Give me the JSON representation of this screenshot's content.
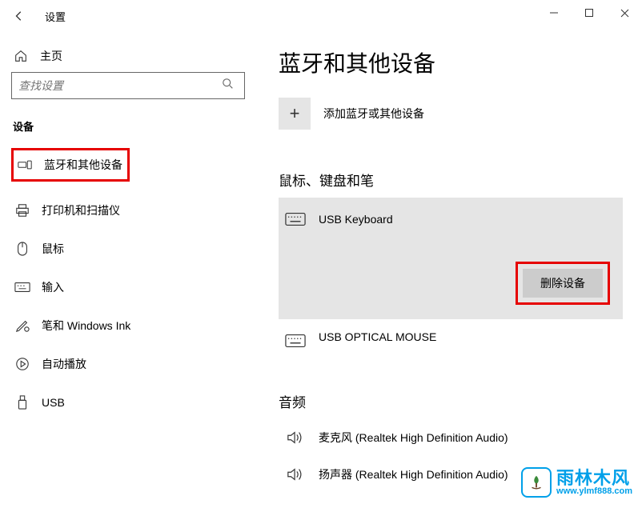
{
  "window": {
    "title": "设置"
  },
  "sidebar": {
    "home": "主页",
    "search_placeholder": "查找设置",
    "category": "设备",
    "items": [
      {
        "label": "蓝牙和其他设备"
      },
      {
        "label": "打印机和扫描仪"
      },
      {
        "label": "鼠标"
      },
      {
        "label": "输入"
      },
      {
        "label": "笔和 Windows Ink"
      },
      {
        "label": "自动播放"
      },
      {
        "label": "USB"
      }
    ]
  },
  "main": {
    "page_title": "蓝牙和其他设备",
    "add_device": "添加蓝牙或其他设备",
    "section_input": "鼠标、键盘和笔",
    "devices": [
      {
        "name": "USB Keyboard"
      },
      {
        "name": "USB OPTICAL MOUSE"
      }
    ],
    "remove_button": "删除设备",
    "section_audio": "音频",
    "audio_devices": [
      {
        "name": "麦克风 (Realtek High Definition Audio)"
      },
      {
        "name": "扬声器 (Realtek High Definition Audio)"
      }
    ]
  },
  "watermark": {
    "line1": "雨林木风",
    "line2": "www.ylmf888.com"
  }
}
